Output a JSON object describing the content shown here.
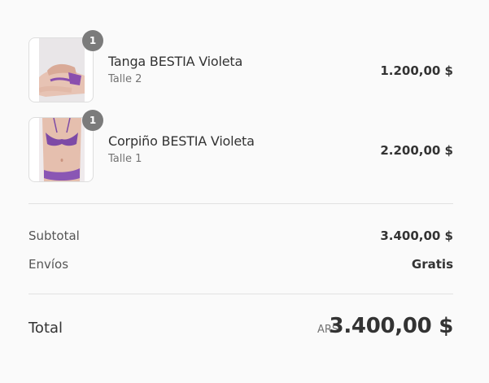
{
  "items": [
    {
      "name": "Tanga BESTIA Violeta",
      "variant": "Talle 2",
      "price": "1.200,00 $",
      "quantity": "1"
    },
    {
      "name": "Corpiño BESTIA Violeta",
      "variant": "Talle 1",
      "price": "2.200,00 $",
      "quantity": "1"
    }
  ],
  "summary": {
    "subtotal_label": "Subtotal",
    "subtotal_value": "3.400,00 $",
    "shipping_label": "Envíos",
    "shipping_value": "Gratis",
    "total_label": "Total",
    "total_currency": "ARS",
    "total_value": "3.400,00 $"
  },
  "colors": {
    "background": "#fafafa",
    "badge": "#7b7b7b",
    "text": "#333333",
    "muted": "#737373",
    "product": "#7a4aa0"
  }
}
